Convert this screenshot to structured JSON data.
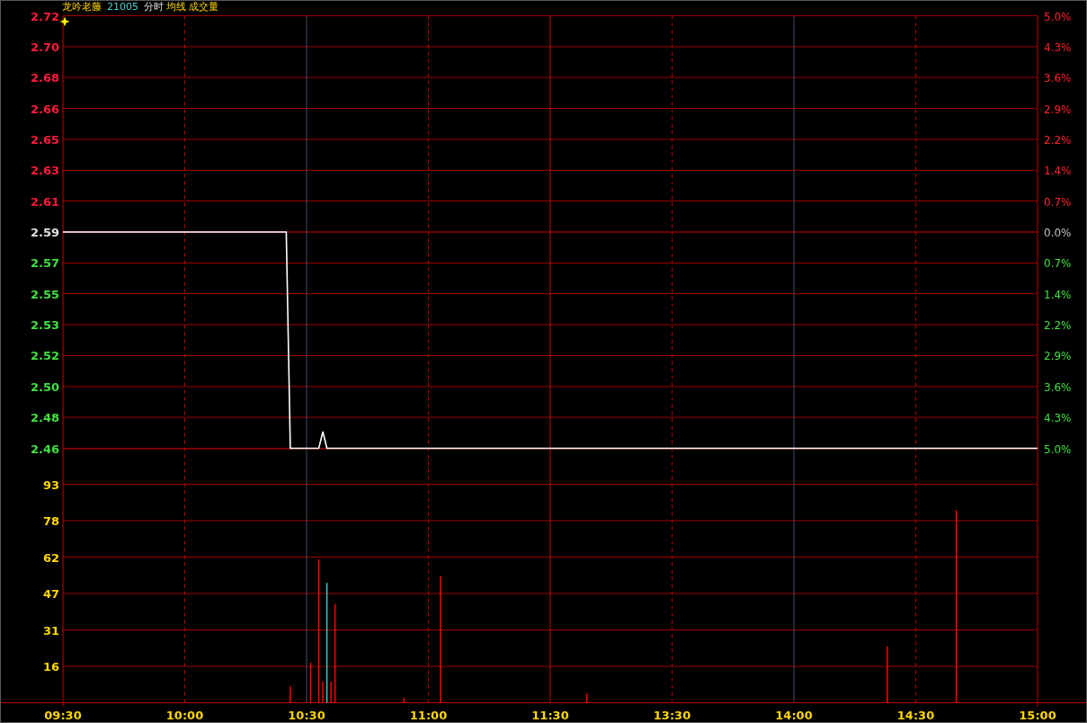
{
  "header": {
    "name": "龙吟老藤",
    "code": "21005",
    "mode": "分时",
    "avg_label": "均线",
    "volume_label": "成交量"
  },
  "price_chart": {
    "chart_data": {
      "type": "line",
      "categories": [
        null,
        null,
        null,
        null,
        null,
        null,
        null,
        null,
        null,
        null,
        null,
        null,
        null,
        null,
        null,
        null,
        null,
        null,
        null,
        null,
        null,
        null,
        null,
        null,
        null,
        null,
        null,
        null,
        null,
        null,
        null,
        null,
        null,
        null,
        null,
        null,
        null,
        null,
        null,
        null,
        null,
        null,
        null,
        null,
        null,
        null,
        null,
        null,
        null,
        null,
        null,
        null,
        null,
        null,
        null,
        null,
        null,
        null,
        null,
        null,
        null,
        null,
        null,
        null,
        null,
        null,
        null,
        null,
        null,
        null,
        null,
        null,
        null,
        null,
        null,
        null,
        null,
        null,
        null,
        null,
        null,
        null,
        null,
        null,
        null,
        null,
        null,
        null,
        null,
        null,
        null,
        null,
        null,
        null,
        null,
        null,
        null,
        null,
        null,
        null,
        null,
        null,
        null,
        null,
        null,
        null,
        null,
        null,
        null,
        null,
        null,
        null,
        null,
        null,
        null,
        null,
        null,
        null,
        null,
        null,
        null,
        null,
        null,
        null,
        null,
        null,
        null,
        null,
        null,
        null,
        null,
        null,
        null,
        null,
        null,
        null,
        null,
        null,
        null,
        null,
        null,
        null,
        null,
        null,
        null,
        null,
        null,
        null,
        null,
        null,
        null,
        null,
        null,
        null,
        null,
        null,
        null,
        null,
        null,
        null,
        null,
        null,
        null,
        null,
        null,
        null,
        null,
        null,
        null,
        null,
        null,
        null,
        null,
        null,
        null,
        null,
        null,
        null,
        null,
        null,
        null,
        null,
        null,
        null,
        null,
        null,
        null,
        null,
        null,
        null,
        null,
        null,
        null,
        null,
        null,
        null,
        null,
        null,
        null,
        null,
        null,
        null,
        null,
        null,
        null,
        null,
        null,
        null,
        null,
        null,
        null,
        null,
        null,
        null,
        null,
        null,
        null,
        null,
        null,
        null,
        null,
        null,
        null,
        null,
        null,
        null,
        null,
        null,
        null,
        null,
        null,
        null,
        null,
        null,
        null,
        null,
        null,
        null,
        null,
        null,
        null
      ],
      "series": [
        {
          "color": "#ffffff",
          "values": [
            2.59,
            2.59,
            2.59,
            2.59,
            2.59,
            2.59,
            2.59,
            2.59,
            2.59,
            2.59,
            2.59,
            2.59,
            2.59,
            2.59,
            2.59,
            2.59,
            2.59,
            2.59,
            2.59,
            2.59,
            2.59,
            2.59,
            2.59,
            2.59,
            2.59,
            2.59,
            2.59,
            2.59,
            2.59,
            2.59,
            2.59,
            2.59,
            2.59,
            2.59,
            2.59,
            2.59,
            2.59,
            2.59,
            2.59,
            2.59,
            2.59,
            2.59,
            2.59,
            2.59,
            2.59,
            2.59,
            2.59,
            2.59,
            2.59,
            2.59,
            2.59,
            2.59,
            2.59,
            2.59,
            2.59,
            2.59,
            2.46,
            2.46,
            2.46,
            2.46,
            2.46,
            2.46,
            2.46,
            2.46,
            2.47,
            2.46,
            2.46,
            2.46,
            2.46,
            2.46,
            2.46,
            2.46,
            2.46,
            2.46,
            2.46,
            2.46,
            2.46,
            2.46,
            2.46,
            2.46,
            2.46,
            2.46,
            2.46,
            2.46,
            2.46,
            2.46,
            2.46,
            2.46,
            2.46,
            2.46,
            2.46,
            2.46,
            2.46,
            2.46,
            2.46,
            2.46,
            2.46,
            2.46,
            2.46,
            2.46,
            2.46,
            2.46,
            2.46,
            2.46,
            2.46,
            2.46,
            2.46,
            2.46,
            2.46,
            2.46,
            2.46,
            2.46,
            2.46,
            2.46,
            2.46,
            2.46,
            2.46,
            2.46,
            2.46,
            2.46,
            2.46,
            2.46,
            2.46,
            2.46,
            2.46,
            2.46,
            2.46,
            2.46,
            2.46,
            2.46,
            2.46,
            2.46,
            2.46,
            2.46,
            2.46,
            2.46,
            2.46,
            2.46,
            2.46,
            2.46,
            2.46,
            2.46,
            2.46,
            2.46,
            2.46,
            2.46,
            2.46,
            2.46,
            2.46,
            2.46,
            2.46,
            2.46,
            2.46,
            2.46,
            2.46,
            2.46,
            2.46,
            2.46,
            2.46,
            2.46,
            2.46,
            2.46,
            2.46,
            2.46,
            2.46,
            2.46,
            2.46,
            2.46,
            2.46,
            2.46,
            2.46,
            2.46,
            2.46,
            2.46,
            2.46,
            2.46,
            2.46,
            2.46,
            2.46,
            2.46,
            2.46,
            2.46,
            2.46,
            2.46,
            2.46,
            2.46,
            2.46,
            2.46,
            2.46,
            2.46,
            2.46,
            2.46,
            2.46,
            2.46,
            2.46,
            2.46,
            2.46,
            2.46,
            2.46,
            2.46,
            2.46,
            2.46,
            2.46,
            2.46,
            2.46,
            2.46,
            2.46,
            2.46,
            2.46,
            2.46,
            2.46,
            2.46,
            2.46,
            2.46,
            2.46,
            2.46,
            2.46,
            2.46,
            2.46,
            2.46,
            2.46,
            2.46,
            2.46,
            2.46,
            2.46,
            2.46,
            2.46,
            2.46,
            2.46,
            2.46,
            2.46,
            2.46,
            2.46,
            2.46,
            2.46,
            2.46,
            2.46,
            2.46,
            2.46,
            2.46,
            2.46
          ]
        }
      ],
      "ylim": [
        2.46,
        2.72
      ],
      "yticks": [
        {
          "value": 2.72,
          "label": "2.72"
        },
        {
          "value": 2.7014,
          "label": "2.70"
        },
        {
          "value": 2.6829,
          "label": "2.68"
        },
        {
          "value": 2.6643,
          "label": "2.66"
        },
        {
          "value": 2.6457,
          "label": "2.65"
        },
        {
          "value": 2.6271,
          "label": "2.63"
        },
        {
          "value": 2.6086,
          "label": "2.61"
        },
        {
          "value": 2.59,
          "label": "2.59"
        },
        {
          "value": 2.5714,
          "label": "2.57"
        },
        {
          "value": 2.5529,
          "label": "2.55"
        },
        {
          "value": 2.5343,
          "label": "2.53"
        },
        {
          "value": 2.5157,
          "label": "2.52"
        },
        {
          "value": 2.4971,
          "label": "2.50"
        },
        {
          "value": 2.4786,
          "label": "2.48"
        },
        {
          "value": 2.46,
          "label": "2.46"
        }
      ]
    },
    "percent_labels": [
      {
        "label": "5.0%",
        "color": "#ff2030"
      },
      {
        "label": "4.3%",
        "color": "#ff2030"
      },
      {
        "label": "3.6%",
        "color": "#ff2030"
      },
      {
        "label": "2.9%",
        "color": "#ff2030"
      },
      {
        "label": "2.2%",
        "color": "#ff2030"
      },
      {
        "label": "1.4%",
        "color": "#ff2030"
      },
      {
        "label": "0.7%",
        "color": "#ff2030"
      },
      {
        "label": "0.0%",
        "color": "#c0c0c0"
      },
      {
        "label": "0.7%",
        "color": "#40e040"
      },
      {
        "label": "1.4%",
        "color": "#40e040"
      },
      {
        "label": "2.2%",
        "color": "#40e040"
      },
      {
        "label": "2.9%",
        "color": "#40e040"
      },
      {
        "label": "3.6%",
        "color": "#40e040"
      },
      {
        "label": "4.3%",
        "color": "#40e040"
      },
      {
        "label": "5.0%",
        "color": "#40e040"
      }
    ]
  },
  "volume_chart": {
    "chart_data": {
      "type": "bar",
      "stacked": true,
      "categories": [
        "09:30",
        null,
        null,
        null,
        null,
        null,
        null,
        null,
        null,
        null,
        null,
        null,
        null,
        null,
        null,
        null,
        null,
        null,
        null,
        null,
        null,
        null,
        null,
        null,
        null,
        null,
        null,
        null,
        null,
        null,
        "10:00",
        null,
        null,
        null,
        null,
        null,
        null,
        null,
        null,
        null,
        null,
        null,
        null,
        null,
        null,
        null,
        null,
        null,
        null,
        null,
        null,
        null,
        null,
        null,
        null,
        null,
        null,
        null,
        null,
        null,
        "10:30",
        null,
        null,
        null,
        null,
        null,
        null,
        null,
        null,
        null,
        null,
        null,
        null,
        null,
        null,
        null,
        null,
        null,
        null,
        null,
        null,
        null,
        null,
        null,
        null,
        null,
        null,
        null,
        null,
        null,
        "11:00",
        null,
        null,
        null,
        null,
        null,
        null,
        null,
        null,
        null,
        null,
        null,
        null,
        null,
        null,
        null,
        null,
        null,
        null,
        null,
        null,
        null,
        null,
        null,
        null,
        null,
        null,
        null,
        null,
        null,
        "11:30",
        null,
        null,
        null,
        null,
        null,
        null,
        null,
        null,
        null,
        null,
        null,
        null,
        null,
        null,
        null,
        null,
        null,
        null,
        null,
        null,
        null,
        null,
        null,
        null,
        null,
        null,
        null,
        null,
        null,
        "13:30",
        null,
        null,
        null,
        null,
        null,
        null,
        null,
        null,
        null,
        null,
        null,
        null,
        null,
        null,
        null,
        null,
        null,
        null,
        null,
        null,
        null,
        null,
        null,
        null,
        null,
        null,
        null,
        null,
        null,
        "14:00",
        null,
        null,
        null,
        null,
        null,
        null,
        null,
        null,
        null,
        null,
        null,
        null,
        null,
        null,
        null,
        null,
        null,
        null,
        null,
        null,
        null,
        null,
        null,
        null,
        null,
        null,
        null,
        null,
        null,
        "14:30",
        null,
        null,
        null,
        null,
        null,
        null,
        null,
        null,
        null,
        null,
        null,
        null,
        null,
        null,
        null,
        null,
        null,
        null,
        null,
        null,
        null,
        null,
        null,
        null,
        null,
        null,
        null,
        null,
        null,
        "15:00"
      ],
      "series": [
        {
          "color": "#ff0000",
          "values": [
            null,
            null,
            null,
            null,
            null,
            null,
            null,
            null,
            null,
            null,
            null,
            null,
            null,
            null,
            null,
            null,
            null,
            null,
            null,
            null,
            null,
            null,
            null,
            null,
            null,
            null,
            null,
            null,
            null,
            null,
            null,
            null,
            null,
            null,
            null,
            null,
            null,
            null,
            null,
            null,
            null,
            null,
            null,
            null,
            null,
            null,
            null,
            null,
            null,
            null,
            null,
            null,
            null,
            null,
            null,
            null,
            7,
            null,
            null,
            null,
            null,
            17,
            null,
            61,
            9,
            null,
            9,
            42,
            null,
            null,
            null,
            null,
            null,
            null,
            null,
            null,
            null,
            null,
            null,
            null,
            null,
            null,
            null,
            null,
            2,
            null,
            null,
            null,
            null,
            null,
            null,
            null,
            null,
            54,
            null,
            null,
            null,
            null,
            null,
            null,
            null,
            null,
            null,
            null,
            null,
            null,
            null,
            null,
            null,
            null,
            null,
            null,
            null,
            null,
            null,
            null,
            null,
            null,
            null,
            null,
            null,
            null,
            null,
            null,
            null,
            null,
            null,
            null,
            null,
            4,
            null,
            null,
            null,
            null,
            null,
            null,
            null,
            null,
            null,
            null,
            null,
            null,
            null,
            null,
            null,
            null,
            null,
            null,
            null,
            null,
            null,
            null,
            null,
            null,
            null,
            null,
            null,
            null,
            null,
            null,
            null,
            null,
            null,
            null,
            null,
            null,
            null,
            null,
            null,
            null,
            null,
            null,
            null,
            null,
            null,
            null,
            null,
            null,
            null,
            null,
            null,
            null,
            null,
            null,
            null,
            null,
            null,
            null,
            null,
            null,
            null,
            null,
            null,
            null,
            null,
            null,
            null,
            null,
            null,
            null,
            null,
            null,
            null,
            24,
            null,
            null,
            null,
            null,
            null,
            null,
            null,
            null,
            null,
            null,
            null,
            null,
            null,
            null,
            null,
            null,
            82,
            null,
            null,
            null,
            null,
            null,
            null,
            null,
            null,
            null,
            null,
            null,
            null,
            null,
            null,
            null,
            null,
            null,
            null,
            null,
            null
          ]
        },
        {
          "color": "#40c8c8",
          "values": [
            null,
            null,
            null,
            null,
            null,
            null,
            null,
            null,
            null,
            null,
            null,
            null,
            null,
            null,
            null,
            null,
            null,
            null,
            null,
            null,
            null,
            null,
            null,
            null,
            null,
            null,
            null,
            null,
            null,
            null,
            null,
            null,
            null,
            null,
            null,
            null,
            null,
            null,
            null,
            null,
            null,
            null,
            null,
            null,
            null,
            null,
            null,
            null,
            null,
            null,
            null,
            null,
            null,
            null,
            null,
            null,
            null,
            null,
            null,
            null,
            null,
            null,
            null,
            null,
            null,
            51,
            null,
            null,
            null,
            null,
            null,
            null,
            null,
            null,
            null,
            null,
            null,
            null,
            null,
            null,
            null,
            null,
            null,
            null,
            null,
            null,
            null,
            null,
            null,
            null,
            null,
            null,
            null,
            null,
            null,
            null,
            null,
            null,
            null,
            null,
            null,
            null,
            null,
            null,
            null,
            null,
            null,
            null,
            null,
            null,
            null,
            null,
            null,
            null,
            null,
            null,
            null,
            null,
            null,
            null,
            null,
            null,
            null,
            null,
            null,
            null,
            null,
            null,
            null,
            null,
            null,
            null,
            null,
            null,
            null,
            null,
            null,
            null,
            null,
            null,
            null,
            null,
            null,
            null,
            null,
            null,
            null,
            null,
            null,
            null,
            null,
            null,
            null,
            null,
            null,
            null,
            null,
            null,
            null,
            null,
            null,
            null,
            null,
            null,
            null,
            null,
            null,
            null,
            null,
            null,
            null,
            null,
            null,
            null,
            null,
            null,
            null,
            null,
            null,
            null,
            null,
            null,
            null,
            null,
            null,
            null,
            null,
            null,
            null,
            null,
            null,
            null,
            null,
            null,
            null,
            null,
            null,
            null,
            null,
            null,
            null,
            null,
            null,
            null,
            null,
            null,
            null,
            null,
            null,
            null,
            null,
            null,
            null,
            null,
            null,
            null,
            null,
            null,
            null,
            null,
            null,
            null,
            null,
            null,
            null,
            null,
            null,
            null,
            null,
            null,
            null,
            null,
            null,
            null,
            null,
            null,
            null,
            null,
            null,
            null,
            null
          ]
        }
      ],
      "ylim": [
        0,
        93
      ],
      "yticks": [
        {
          "value": 15.5,
          "label": "16"
        },
        {
          "value": 31,
          "label": "31"
        },
        {
          "value": 46.5,
          "label": "47"
        },
        {
          "value": 62,
          "label": "62"
        },
        {
          "value": 77.5,
          "label": "78"
        },
        {
          "value": 93,
          "label": "93"
        }
      ]
    }
  }
}
